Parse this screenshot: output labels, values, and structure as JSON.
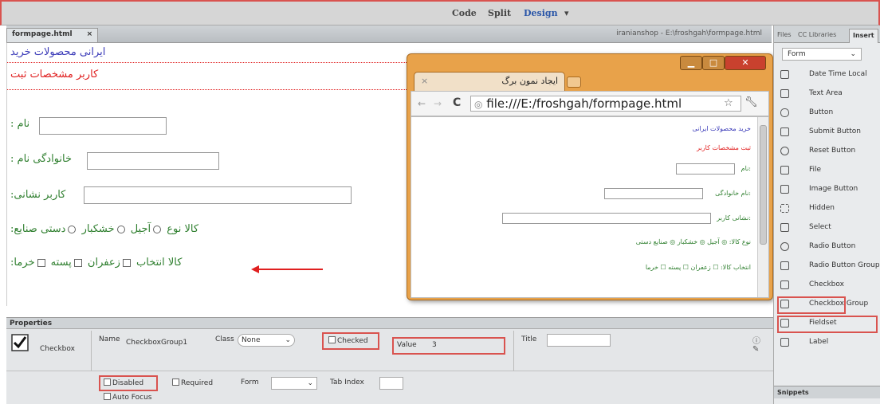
{
  "toolbar": {
    "code": "Code",
    "split": "Split",
    "design": "Design",
    "dropdown": "▾"
  },
  "doc_tab": {
    "name": "formpage.html",
    "close": "×",
    "path": "iranianshop - E:\\froshgah\\formpage.html"
  },
  "design_view": {
    "title": "ایرانی محصولات خرید",
    "subtitle": "کاربر مشخصات ثبت",
    "name_label": ": نام",
    "family_label": ": خانوادگی نام",
    "address_label": ":کاربر نشانی",
    "radio_label": ":کالا نوع",
    "radio_options": [
      "آجیل",
      "خشکبار",
      "دستی صنایع"
    ],
    "check_label": ":کالا انتخاب",
    "check_options": [
      "زعفران",
      "پسته",
      "خرما"
    ]
  },
  "browser": {
    "tab_title": "ایجاد نمون برگ",
    "tab_close": "×",
    "url": "file:///E:/froshgah/formpage.html",
    "title": "خرید محصولات ایرانی",
    "subtitle": "ثبت مشخصات کاربر",
    "name_label": "نام:",
    "family_label": "نام خانوادگی:",
    "address_label": "نشانی کاربر:",
    "radio_row": "نوع کالا: ◎ آجیل ◎ خشکبار ◎ صنایع دستی",
    "check_row": "انتخاب کالا: ☐ زعفران ☐ پسته ☐ خرما"
  },
  "properties": {
    "header": "Properties",
    "type": "Checkbox",
    "name_label": "Name",
    "name_value": "CheckboxGroup1",
    "class_label": "Class",
    "class_value": "None",
    "checked": "Checked",
    "value_label": "Value",
    "value": "3",
    "title_label": "Title",
    "disabled": "Disabled",
    "required": "Required",
    "form_label": "Form",
    "tabindex_label": "Tab Index",
    "autofocus": "Auto Focus"
  },
  "insert_panel": {
    "tabs": [
      "Files",
      "CC Libraries",
      "Insert"
    ],
    "category": "Form",
    "items": [
      "Date Time Local",
      "Text Area",
      "Button",
      "Submit Button",
      "Reset Button",
      "File",
      "Image Button",
      "Hidden",
      "Select",
      "Radio Button",
      "Radio Button Group",
      "Checkbox",
      "Checkbox Group",
      "Fieldset",
      "Label"
    ],
    "snippets": "Snippets"
  },
  "colors": {
    "highlight": "#d9534f",
    "arrow": "#e02020",
    "browser_frame": "#e8a24a"
  }
}
